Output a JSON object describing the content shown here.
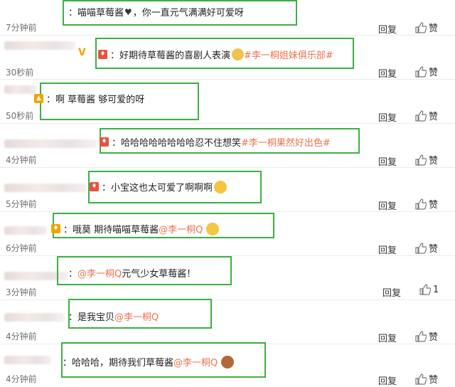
{
  "comments": [
    {
      "prefix": "：",
      "text": "喵喵草莓酱",
      "after": "，你一直元气满满好可爱呀",
      "time": "7分钟前",
      "reply": "回复",
      "like": "赞",
      "emoji": "heart-icon"
    },
    {
      "prefix": "：",
      "text": "好期待草莓酱的喜剧人表演",
      "tag": "#李一桐姐妹俱乐部#",
      "time": "30秒前",
      "reply": "回复",
      "like": "赞",
      "emoji": "doge-icon"
    },
    {
      "prefix": "：",
      "text": "啊 草莓酱 够可爱的呀",
      "time": "50秒前",
      "reply": "回复",
      "like": "赞"
    },
    {
      "prefix": "：",
      "text": "哈哈哈哈哈哈哈哈忍不住想笑",
      "tag": "#李一桐果然好出色#",
      "time": "4分钟前",
      "reply": "回复",
      "like": "赞"
    },
    {
      "prefix": "：",
      "text": "小宝这也太可爱了啊啊啊",
      "time": "5分钟前",
      "reply": "回复",
      "like": "赞",
      "emoji": "kiss-face-icon"
    },
    {
      "prefix": "：",
      "text": "哦莫 期待喵喵草莓酱",
      "mention": "@李一桐Q",
      "time": "6分钟前",
      "reply": "回复",
      "like": "赞",
      "emoji": "crying-face-icon"
    },
    {
      "prefix": "：",
      "mention": "@李一桐Q",
      "text": " 元气少女草莓酱！",
      "time": "3分钟前",
      "reply": "回复",
      "like": "1"
    },
    {
      "prefix": "：",
      "text": "是我宝贝",
      "mention": "@李一桐Q",
      "time": "4分钟前",
      "reply": "回复",
      "like": "赞"
    },
    {
      "prefix": "：",
      "text": "哈哈哈，期待我们草莓酱",
      "mention": "@李一桐Q",
      "time": "4分钟前",
      "reply": "回复",
      "like": "赞",
      "emoji": "bear-face-icon"
    }
  ]
}
